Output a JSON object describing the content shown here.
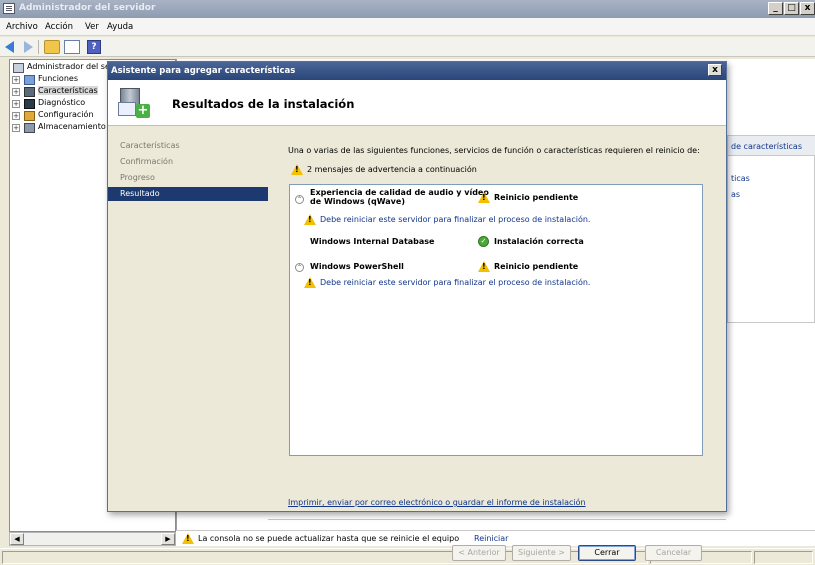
{
  "window": {
    "title": "Administrador del servidor",
    "controls": [
      "_",
      "□",
      "x"
    ]
  },
  "menu": [
    "Archivo",
    "Acción",
    "Ver",
    "Ayuda"
  ],
  "tree": {
    "root": "Administrador del se",
    "items": [
      "Funciones",
      "Características",
      "Diagnóstico",
      "Configuración",
      "Almacenamiento"
    ]
  },
  "actions": {
    "header": "de características",
    "links": [
      "ticas",
      "as"
    ]
  },
  "statusbar": {
    "message": "La consola no se puede actualizar hasta que se reinicie el equipo",
    "link": "Reiniciar"
  },
  "dialog": {
    "title": "Asistente para agregar características",
    "close": "x",
    "header_title": "Resultados de la instalación",
    "nav": [
      "Características",
      "Confirmación",
      "Progreso",
      "Resultado"
    ],
    "active_nav": "Resultado",
    "intro": "Una o varias de las siguientes funciones, servicios de función o características requieren el reinicio de:",
    "warning_summary": "2 mensajes de advertencia a continuación",
    "features": [
      {
        "name_line1": "Experiencia de calidad de audio y vídeo",
        "name_line2": "de Windows (qWave)",
        "status": "Reinicio pendiente",
        "detail": "Debe reiniciar este servidor para finalizar el proceso de instalación."
      },
      {
        "name": "Windows Internal Database",
        "status": "Instalación correcta"
      },
      {
        "name": "Windows PowerShell",
        "status": "Reinicio pendiente",
        "detail": "Debe reiniciar este servidor para finalizar el proceso de instalación."
      }
    ],
    "print_link": "Imprimir, enviar por correo electrónico o guardar el informe de instalación",
    "buttons": {
      "back": "< Anterior",
      "next": "Siguiente >",
      "close": "Cerrar",
      "cancel": "Cancelar"
    }
  },
  "colors": {
    "dialog_title": "#29467a",
    "nav_active": "#1c3a6f",
    "link": "#10368c",
    "warning": "#f2c000",
    "success": "#4fa63a"
  }
}
